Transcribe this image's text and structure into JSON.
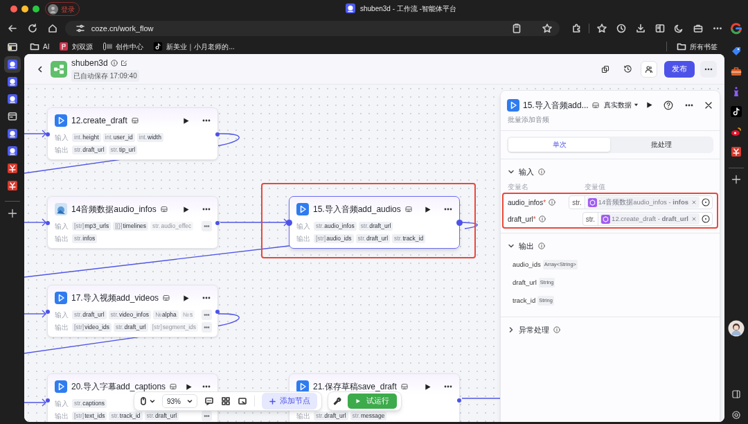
{
  "browser": {
    "profile_label": "登录",
    "tab_title": "shuben3d - 工作流 -智能体平台",
    "url": "coze.cn/work_flow",
    "bookmarks": [
      {
        "kind": "folder",
        "label": "AI"
      },
      {
        "kind": "red-app",
        "label": "刘双源"
      },
      {
        "kind": "bars",
        "label": "创作中心"
      },
      {
        "kind": "tiktok",
        "label": "新美业｜小月老师的..."
      }
    ],
    "all_bookmarks": "所有书签",
    "left_sidebar": [
      {
        "kind": "layout",
        "selected": false
      },
      {
        "kind": "bot",
        "selected": true
      },
      {
        "kind": "bot",
        "selected": false
      },
      {
        "kind": "bot",
        "selected": false
      },
      {
        "kind": "calendar",
        "selected": false
      },
      {
        "kind": "bot",
        "selected": false
      },
      {
        "kind": "bot",
        "selected": false
      },
      {
        "kind": "red-app",
        "selected": false
      },
      {
        "kind": "red-app",
        "selected": false
      }
    ],
    "right_sidebar": [
      {
        "kind": "tag"
      },
      {
        "kind": "briefcase"
      },
      {
        "kind": "chess"
      },
      {
        "kind": "tiktok"
      },
      {
        "kind": "weibo"
      },
      {
        "kind": "red-app"
      }
    ]
  },
  "app": {
    "title": "shuben3d",
    "save_status": "已自动保存 17:09:40",
    "publish_button": "发布"
  },
  "nodes": [
    {
      "title": "12.create_draft",
      "selected": false,
      "highlighted": false,
      "input_label": "输入",
      "output_label": "输出",
      "inputs": [
        {
          "type": "int.",
          "name": "height",
          "faded": false
        },
        {
          "type": "int.",
          "name": "user_id",
          "faded": false
        },
        {
          "type": "int.",
          "name": "width",
          "faded": false
        }
      ],
      "inputs_overflow": false,
      "outputs": [
        {
          "type": "str.",
          "name": "draft_url",
          "faded": false
        },
        {
          "type": "str.",
          "name": "tip_url",
          "faded": false
        }
      ],
      "outputs_overflow": false
    },
    {
      "title": "14音频数据audio_infos",
      "selected": false,
      "highlighted": false,
      "input_label": "输入",
      "output_label": "输出",
      "inputs": [
        {
          "type": "[str]",
          "name": "mp3_urls",
          "faded": false
        },
        {
          "type": "[{}]",
          "name": "timelines",
          "faded": false
        },
        {
          "type": "str.",
          "name": "audio_effec",
          "faded": true
        }
      ],
      "inputs_overflow": true,
      "outputs": [
        {
          "type": "str.",
          "name": "infos",
          "faded": false
        }
      ],
      "outputs_overflow": false
    },
    {
      "title": "15.导入音频add_audios",
      "selected": true,
      "highlighted": true,
      "input_label": "输入",
      "output_label": "输出",
      "inputs": [
        {
          "type": "str.",
          "name": "audio_infos",
          "faded": false
        },
        {
          "type": "str.",
          "name": "draft_url",
          "faded": false
        }
      ],
      "inputs_overflow": false,
      "outputs": [
        {
          "type": "[str]",
          "name": "audio_ids",
          "faded": false
        },
        {
          "type": "str.",
          "name": "draft_url",
          "faded": false
        },
        {
          "type": "str.",
          "name": "track_id",
          "faded": false
        }
      ],
      "outputs_overflow": false
    },
    {
      "title": "17.导入视频add_videos",
      "selected": false,
      "highlighted": false,
      "input_label": "输入",
      "output_label": "输出",
      "inputs": [
        {
          "type": "str.",
          "name": "draft_url",
          "faded": false
        },
        {
          "type": "str.",
          "name": "video_infos",
          "faded": false
        },
        {
          "type": "№",
          "name": "alpha",
          "faded": false
        },
        {
          "type": "№",
          "name": "s",
          "faded": true
        }
      ],
      "inputs_overflow": true,
      "outputs": [
        {
          "type": "[str]",
          "name": "video_ids",
          "faded": false
        },
        {
          "type": "str.",
          "name": "draft_url",
          "faded": false
        },
        {
          "type": "[str]",
          "name": "segment_ids",
          "faded": true
        }
      ],
      "outputs_overflow": true
    },
    {
      "title": "20.导入字幕add_captions",
      "selected": false,
      "highlighted": false,
      "input_label": "输入",
      "output_label": "输出",
      "inputs": [
        {
          "type": "str.",
          "name": "captions",
          "faded": false
        }
      ],
      "inputs_overflow": false,
      "outputs": [
        {
          "type": "[str]",
          "name": "text_ids",
          "faded": false
        },
        {
          "type": "str.",
          "name": "track_id",
          "faded": false
        },
        {
          "type": "str.",
          "name": "draft_url",
          "faded": false
        }
      ],
      "outputs_overflow": true
    },
    {
      "title": "21.保存草稿save_draft",
      "selected": false,
      "highlighted": false,
      "output_label": "输出",
      "outputs": [
        {
          "type": "str.",
          "name": "draft_url",
          "faded": false
        },
        {
          "type": "str.",
          "name": "message",
          "faded": false
        }
      ],
      "outputs_overflow": false
    }
  ],
  "panel": {
    "title": "15.导入音频add...",
    "data_mode": "真实数据",
    "subtitle": "批量添加音频",
    "tabs": [
      {
        "label": "单次",
        "selected": true
      },
      {
        "label": "批处理",
        "selected": false
      }
    ],
    "input_section": {
      "title": "输入",
      "expanded": true,
      "highlighted": true,
      "name_header": "变量名",
      "value_header": "变量值",
      "rows": [
        {
          "name": "audio_infos",
          "required_mark": "*",
          "type": "str.",
          "reference": "14音频数据audio_infos - **infos**"
        },
        {
          "name": "draft_url",
          "required_mark": "*",
          "type": "str.",
          "reference": "12.create_draft - **draft_url**"
        }
      ]
    },
    "output_section": {
      "title": "输出",
      "expanded": true,
      "rows": [
        {
          "name": "audio_ids",
          "type": "Array<String>"
        },
        {
          "name": "draft_url",
          "type": "String"
        },
        {
          "name": "track_id",
          "type": "String"
        }
      ]
    },
    "error_section": {
      "title": "异常处理",
      "expanded": false
    }
  },
  "toolbar": {
    "zoom": "93%",
    "add_node": "添加节点",
    "test_run": "试运行"
  }
}
